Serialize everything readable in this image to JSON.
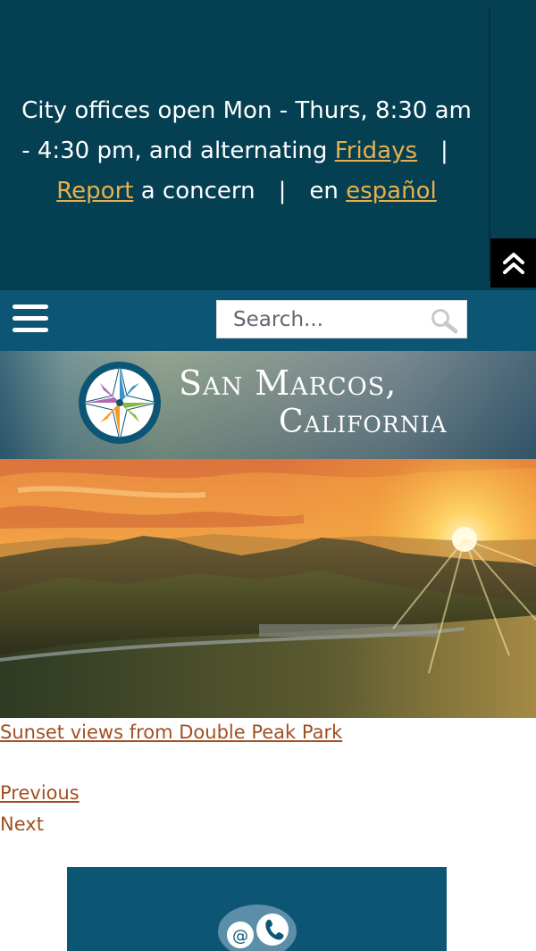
{
  "announcement": {
    "line1": "City offices open Mon - Thurs, 8:30 am",
    "line2_prefix": "- 4:30 pm, and alternating ",
    "fridays_link": "Fridays",
    "pipe": "|",
    "report_link": "Report",
    "report_suffix": " a concern",
    "en_label": "en ",
    "espanol_link": "español"
  },
  "scroll_top_icon": "double-chevron-up-icon",
  "navbar": {
    "menu_icon": "hamburger-menu-icon",
    "search_placeholder": "Search...",
    "search_icon": "magnifier-icon"
  },
  "logo": {
    "line1": "San Marcos,",
    "line2": "California",
    "icon": "compass-star-logo"
  },
  "hero": {
    "caption": "Sunset views from Double Peak Park"
  },
  "carousel": {
    "previous": "Previous",
    "next": "Next"
  },
  "contact_card": {
    "icon": "email-phone-icon"
  },
  "colors": {
    "banner_bg": "#053f52",
    "navbar_bg": "#0d5575",
    "link_gold": "#e8b04c",
    "link_brown": "#a14f22"
  }
}
